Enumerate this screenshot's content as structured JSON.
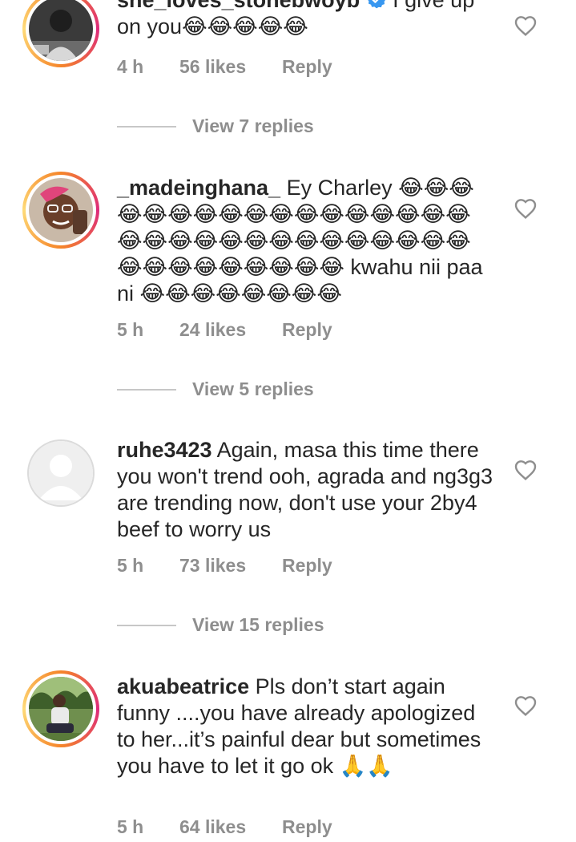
{
  "comments": [
    {
      "username": "she_loves_stonebwoyb",
      "verified": true,
      "text": "I give up on you😂😂😂😂😂",
      "time": "4 h",
      "likes": "56 likes",
      "reply_label": "Reply",
      "view_replies": "View 7 replies",
      "story_ring": true
    },
    {
      "username": "_madeinghana_",
      "verified": false,
      "text": "Ey Charley 😂😂😂😂😂😂😂😂😂😂😂😂😂😂😂😂😂😂😂😂😂😂😂😂😂😂😂😂😂😂😂😂😂😂😂😂😂😂😂😂 kwahu nii paa ni 😂😂😂😂😂😂😂😂",
      "time": "5 h",
      "likes": "24 likes",
      "reply_label": "Reply",
      "view_replies": "View 5 replies",
      "story_ring": true
    },
    {
      "username": "ruhe3423",
      "verified": false,
      "text": "Again, masa this time there you won't trend ooh, agrada and ng3g3 are trending now, don't use your 2by4 beef to worry us",
      "time": "5 h",
      "likes": "73 likes",
      "reply_label": "Reply",
      "view_replies": "View 15 replies",
      "story_ring": false
    },
    {
      "username": "akuabeatrice",
      "verified": false,
      "text": "Pls don’t start again funny ....you have already apologized to her...it’s painful dear but sometimes you have to let it go ok 🙏🙏",
      "time": "5 h",
      "likes": "64 likes",
      "reply_label": "Reply",
      "story_ring": true
    }
  ],
  "icons": {
    "heart": "heart-outline-icon",
    "verified": "verified-badge-icon",
    "default_avatar": "default-avatar-icon"
  },
  "colors": {
    "text": "#262626",
    "muted": "#8e8e8e",
    "verified_blue": "#3897f0",
    "story_ring_start": "#f58529",
    "story_ring_end": "#dd2a7b"
  }
}
